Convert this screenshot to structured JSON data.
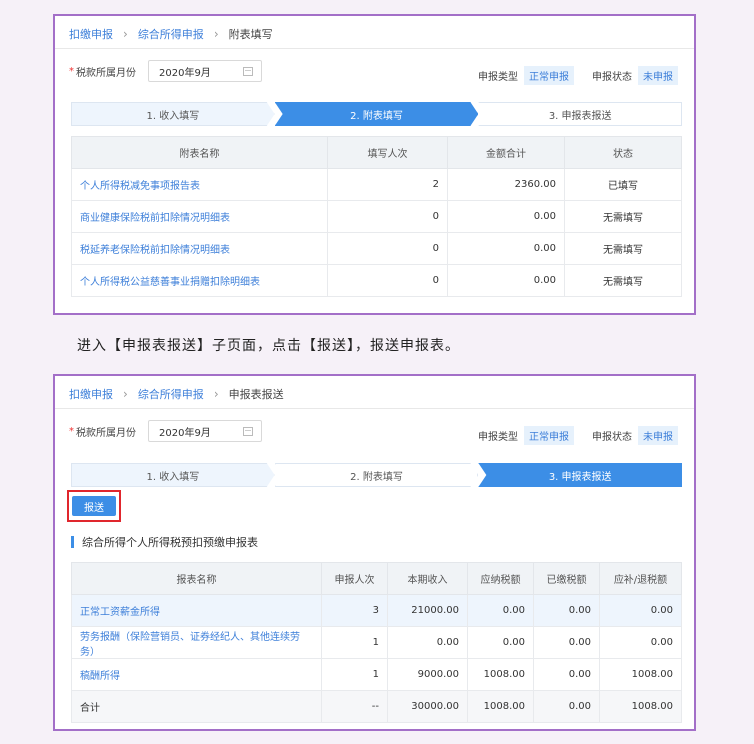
{
  "panel1": {
    "breadcrumb": [
      "扣缴申报",
      "综合所得申报",
      "附表填写"
    ],
    "month_label": "税款所属月份",
    "month_value": "2020年9月",
    "report_type_label": "申报类型",
    "report_type_value": "正常申报",
    "report_status_label": "申报状态",
    "report_status_value": "未申报",
    "steps": [
      "1. 收入填写",
      "2. 附表填写",
      "3. 申报表报送"
    ],
    "table": {
      "headers": [
        "附表名称",
        "填写人次",
        "金额合计",
        "状态"
      ],
      "rows": [
        [
          "个人所得税减免事项报告表",
          "2",
          "2360.00",
          "已填写"
        ],
        [
          "商业健康保险税前扣除情况明细表",
          "0",
          "0.00",
          "无需填写"
        ],
        [
          "税延养老保险税前扣除情况明细表",
          "0",
          "0.00",
          "无需填写"
        ],
        [
          "个人所得税公益慈善事业捐赠扣除明细表",
          "0",
          "0.00",
          "无需填写"
        ]
      ]
    }
  },
  "instruction": "进入【申报表报送】子页面，点击【报送】，报送申报表。",
  "panel2": {
    "breadcrumb": [
      "扣缴申报",
      "综合所得申报",
      "申报表报送"
    ],
    "month_label": "税款所属月份",
    "month_value": "2020年9月",
    "report_type_label": "申报类型",
    "report_type_value": "正常申报",
    "report_status_label": "申报状态",
    "report_status_value": "未申报",
    "steps": [
      "1. 收入填写",
      "2. 附表填写",
      "3. 申报表报送"
    ],
    "submit_label": "报送",
    "section_title": "综合所得个人所得税预扣预缴申报表",
    "table": {
      "headers": [
        "报表名称",
        "申报人次",
        "本期收入",
        "应纳税额",
        "已缴税额",
        "应补/退税额"
      ],
      "rows": [
        [
          "正常工资薪金所得",
          "3",
          "21000.00",
          "0.00",
          "0.00",
          "0.00"
        ],
        [
          "劳务报酬（保险营销员、证券经纪人、其他连续劳务）",
          "1",
          "0.00",
          "0.00",
          "0.00",
          "0.00"
        ],
        [
          "稿酬所得",
          "1",
          "9000.00",
          "1008.00",
          "0.00",
          "1008.00"
        ],
        [
          "合计",
          "--",
          "30000.00",
          "1008.00",
          "0.00",
          "1008.00"
        ]
      ]
    }
  },
  "colors": {
    "accent": "#3c8ee6",
    "link": "#3d7fd9",
    "frame": "#a36fc8",
    "highlight_box": "#e0262d"
  }
}
